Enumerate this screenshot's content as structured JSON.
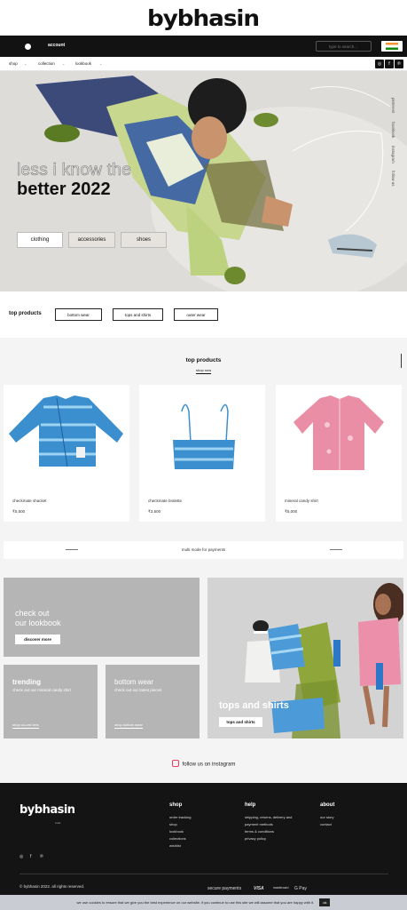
{
  "brand": {
    "logo": "bybhasin"
  },
  "topbar": {
    "account_label": "account",
    "search_placeholder": "type to search..."
  },
  "nav": {
    "items": [
      "shop",
      "collection",
      "lookbook"
    ]
  },
  "hero": {
    "line1": "less i know the",
    "line2": "better 2022",
    "buttons": [
      "clothing",
      "accessories",
      "shoes"
    ],
    "side_links": [
      "pinterest",
      "facebook",
      "instagram",
      "follow us"
    ]
  },
  "top_products_strip": {
    "title": "top products",
    "tabs": [
      "bottom wear",
      "tops and shirts",
      "outer wear"
    ]
  },
  "products": {
    "title": "top products",
    "shop_now": "shop now",
    "items": [
      {
        "name": "checkmate shacket",
        "price": "₹5,500"
      },
      {
        "name": "checkmate bralette",
        "price": "₹3,500"
      },
      {
        "name": "mineral candy shirt",
        "price": "₹5,000"
      }
    ],
    "payment_note": "multi mode for payments"
  },
  "lookbook": {
    "main_title_1": "check out",
    "main_title_2": "our lookbook",
    "main_button": "discover more",
    "trending_title": "trending",
    "trending_sub": "check out our mineral candy shirt",
    "trending_link": "shop co-ord sets",
    "bottom_title": "bottom wear",
    "bottom_sub": "check out our latest pieces",
    "bottom_link": "shop bottom wear",
    "tops_title": "tops and shirts",
    "tops_button": "tops and shirts"
  },
  "instagram": {
    "label": "follow us on instagram"
  },
  "footer": {
    "logo": "bybhasin",
    "logo_sub": "india",
    "shop_heading": "shop",
    "shop_links": [
      "order tracking",
      "shop",
      "lookbook",
      "collections",
      "wishlist"
    ],
    "help_heading": "help",
    "help_links": [
      "shipping, returns, delivery and",
      "payment methods",
      "terms & conditions",
      "privacy policy"
    ],
    "about_heading": "about",
    "about_links": [
      "our story",
      "contact"
    ],
    "social_icons": [
      "instagram-icon",
      "facebook-icon",
      "pinterest-icon"
    ],
    "copyright": "© bybhasin 2022. all rights reserved.",
    "secure_payments": "secure payments",
    "payment_logos": [
      "VISA",
      "mastercard",
      "G Pay"
    ]
  },
  "cookie": {
    "message": "we use cookies to ensure that we give you the best experience on our website. if you continue to use this site we will assume that you are happy with it.",
    "ok_label": "ok"
  },
  "colors": {
    "topbar": "#121212",
    "footer": "#141414",
    "tile": "#b5b5b5",
    "accent_instagram": "#e4405f"
  }
}
